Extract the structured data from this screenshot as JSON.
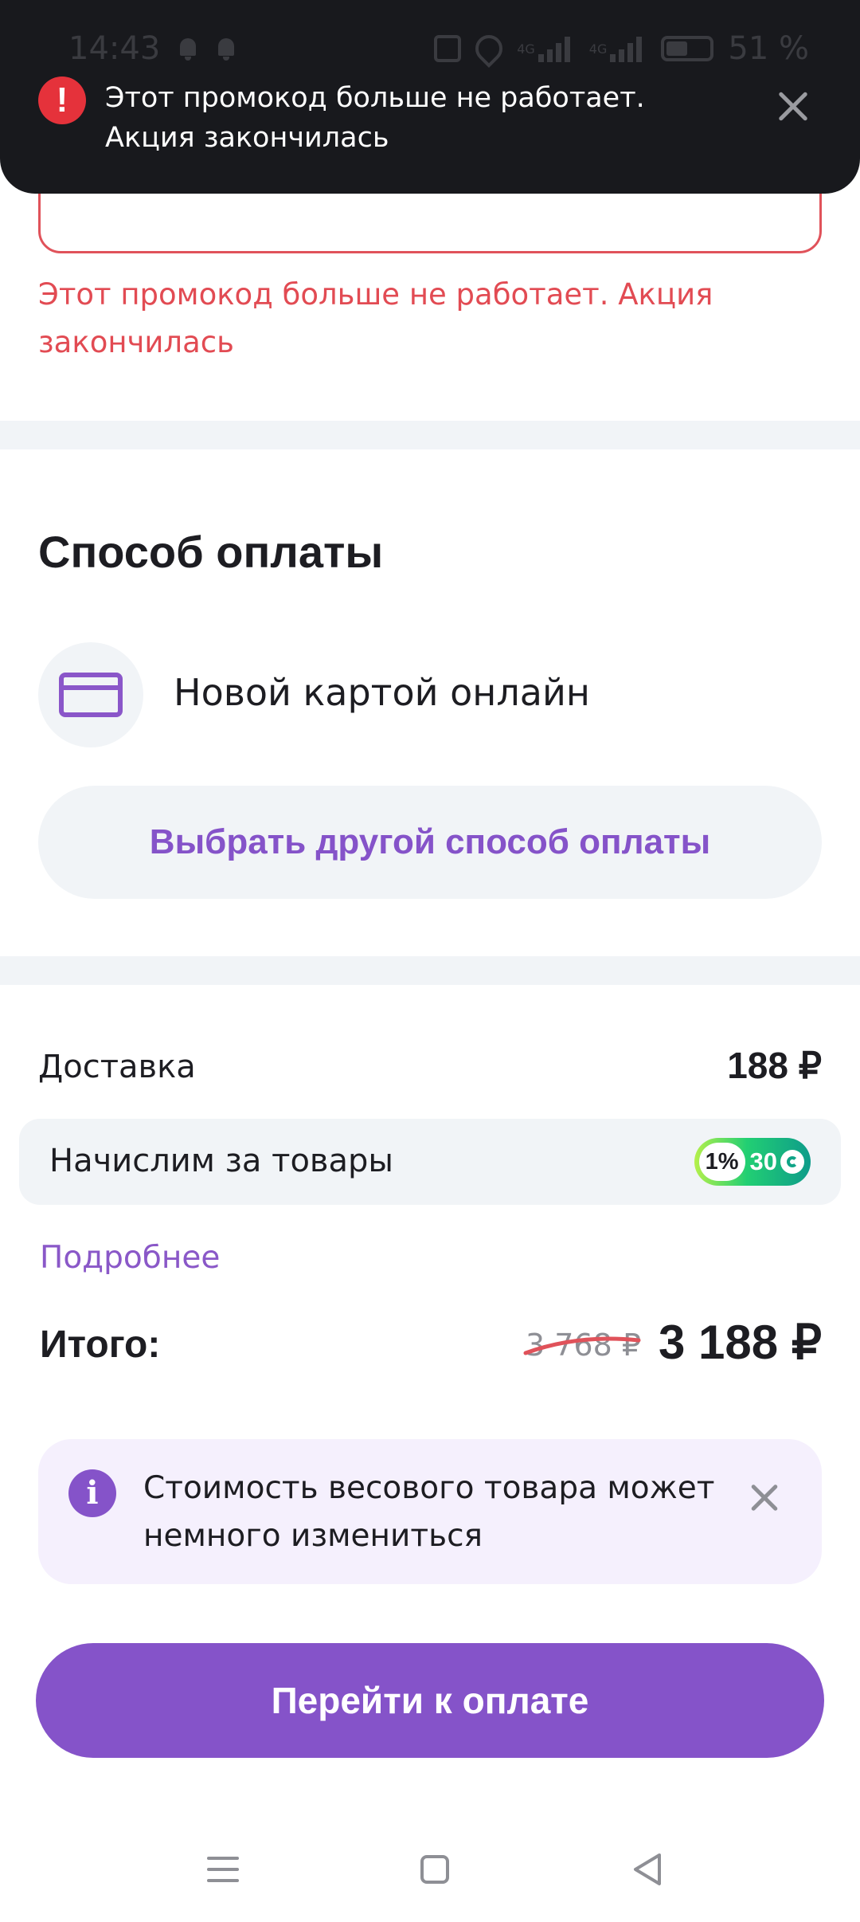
{
  "status_bar": {
    "time": "14:43",
    "signal_1": "4G",
    "signal_2": "4G",
    "battery": "51 %"
  },
  "toast": {
    "message": "Этот промокод больше не работает. Акция закончилась"
  },
  "promo": {
    "input_value": "",
    "error": "Этот промокод больше не работает. Акция закончилась"
  },
  "payment": {
    "title": "Способ оплаты",
    "method": "Новой картой онлайн",
    "choose_other": "Выбрать другой способ оплаты"
  },
  "summary": {
    "delivery_label": "Доставка",
    "delivery_value": "188 ₽",
    "bonus_label": "Начислим за товары",
    "bonus_percent": "1%",
    "bonus_amount": "30",
    "more_link": "Подробнее",
    "total_label": "Итого:",
    "old_price": "3 768 ₽",
    "total_value": "3 188 ₽"
  },
  "notice": {
    "text": "Стоимость весового товара может немного измениться"
  },
  "checkout": {
    "pay_button": "Перейти к оплате"
  },
  "colors": {
    "accent": "#8553c9",
    "error": "#e24b53",
    "toast_bg": "#18191d",
    "surface": "#f1f4f7"
  }
}
